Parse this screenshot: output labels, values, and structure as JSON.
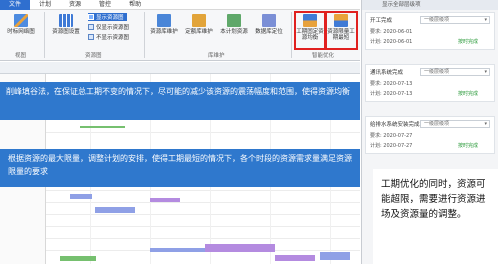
{
  "menu": {
    "items": [
      "文件",
      "计划",
      "资源",
      "管控",
      "帮助"
    ],
    "active_index": 0
  },
  "ribbon": {
    "view_group": {
      "label": "视图",
      "buttons": [
        "时标网络图"
      ]
    },
    "resource_group": {
      "label": "资源图",
      "big_button": "资源图设置",
      "toggles": [
        "显示资源图",
        "仅显示资源图",
        "不显示资源图"
      ]
    },
    "library_group": {
      "label": "库维护",
      "buttons": [
        "资源库维护",
        "定额库维护",
        "本计划资源",
        "数据库定位"
      ]
    },
    "optimize_group": {
      "label": "智能优化",
      "buttons": [
        "工期固定资源均衡",
        "资源限量工期最短"
      ]
    }
  },
  "banners": {
    "leveling": "削峰填谷法，在保证总工期不变的情况下，尽可能的减少该资源的震荡幅度和范围，使得资源均衡",
    "limited": "根据资源的最大限量，调整计划的安排，使得工期最短的情况下，各个时段的资源需求量满足资源限量的要求"
  },
  "right_panel": {
    "title": "显示全部层级项",
    "cards": [
      {
        "title": "开工完成",
        "level": "一级层级项",
        "req": "要求: 2020-06-01",
        "plan": "计划: 2020-06-01",
        "status": "按时完成"
      },
      {
        "title": "通讯系统完成",
        "level": "一级层级项",
        "req": "要求: 2020-07-13",
        "plan": "计划: 2020-07-13",
        "status": "按时完成"
      },
      {
        "title": "给排水系统安装完成",
        "level": "一级层级项",
        "req": "要求: 2020-07-27",
        "plan": "计划: 2020-07-27",
        "status": "按时完成"
      }
    ]
  },
  "note": "工期优化的同时，资源可能超限，需要进行资源进场及资源量的调整。",
  "colors": {
    "accent": "#2f78cd",
    "highlight_border": "#e0201f",
    "status_ok": "#2a9a3a"
  },
  "icons": [
    "network-chart-icon",
    "resource-settings-icon",
    "library-icon",
    "optimize-icon"
  ]
}
